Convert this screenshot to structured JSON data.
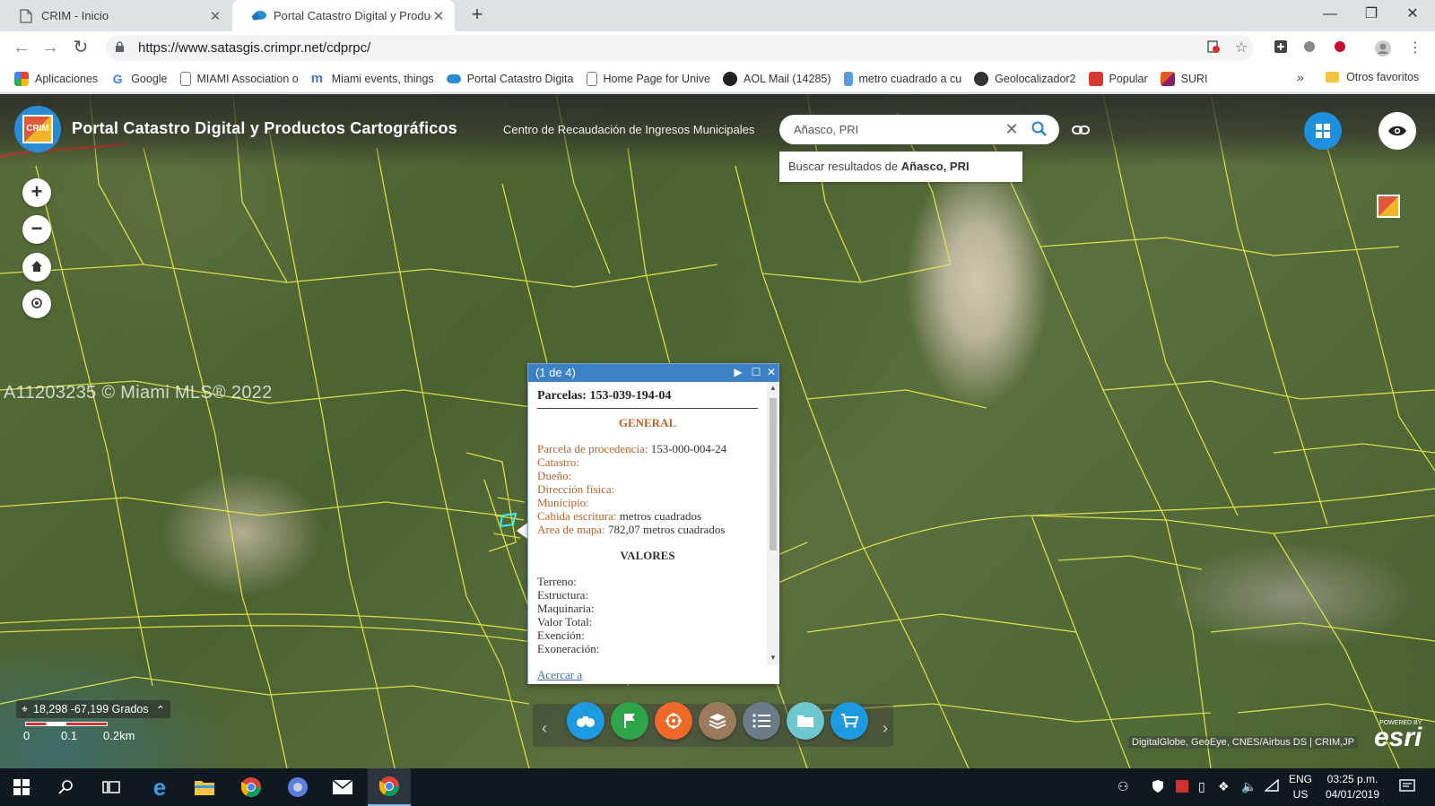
{
  "browser": {
    "tabs": [
      {
        "title": "CRIM - Inicio",
        "active": false
      },
      {
        "title": "Portal Catastro Digital y Producto",
        "active": true
      }
    ],
    "url": "https://www.satasgis.crimpr.net/cdprpc/",
    "bookmarks": [
      {
        "label": "Aplicaciones",
        "icon": "apps-grid-icon",
        "color": "#ea4335"
      },
      {
        "label": "Google",
        "icon": "google-icon",
        "color": "#4285f4"
      },
      {
        "label": "MIAMI Association o",
        "icon": "page-icon",
        "color": "#ffffff"
      },
      {
        "label": "Miami events, things",
        "icon": "m-logo-icon",
        "color": "#4a6fd0"
      },
      {
        "label": "Portal Catastro Digita",
        "icon": "cloud-icon",
        "color": "#2b8ad4"
      },
      {
        "label": "Home Page for Unive",
        "icon": "page-icon",
        "color": "#ffffff"
      },
      {
        "label": "AOL Mail (14285)",
        "icon": "aol-icon",
        "color": "#222222"
      },
      {
        "label": "metro cuadrado a cu",
        "icon": "bookmark-blue-icon",
        "color": "#5a9ae0"
      },
      {
        "label": "Geolocalizador2",
        "icon": "globe-icon",
        "color": "#333333"
      },
      {
        "label": "Popular",
        "icon": "popular-icon",
        "color": "#d6392f"
      },
      {
        "label": "SURI",
        "icon": "suri-icon",
        "color": "#e05a20"
      }
    ],
    "more": "»",
    "other_favorites": "Otros favoritos"
  },
  "app": {
    "title": "Portal Catastro Digital y Productos Cartográficos",
    "subtitle": "Centro de Recaudación de Ingresos Municipales",
    "search_value": "Añasco, PRI",
    "suggestion_prefix": "Buscar resultados de ",
    "suggestion_term": "Añasco, PRI"
  },
  "watermark": "A11203235 © Miami MLS® 2022",
  "popup": {
    "counter": "(1 de 4)",
    "parcel_title": "Parcelas: 153-039-194-04",
    "general_heading": "GENERAL",
    "general_rows": [
      {
        "key": "Parcela de procedencia:",
        "value": "153-000-004-24"
      },
      {
        "key": "Catastro:",
        "value": ""
      },
      {
        "key": "Dueño:",
        "value": ""
      },
      {
        "key": "Dirección física:",
        "value": ""
      },
      {
        "key": "Municipio:",
        "value": ""
      },
      {
        "key": "Cabida escritura:",
        "value": "metros cuadrados"
      },
      {
        "key": "Area de mapa:",
        "value": "782,07 metros cuadrados"
      }
    ],
    "valores_heading": "VALORES",
    "valores_rows": [
      "Terreno:",
      "Estructura:",
      "Maquinaria:",
      "Valor Total:",
      "Exención:",
      "Exoneración:"
    ],
    "footer_link": "Acercar a"
  },
  "map_status": {
    "coordinates": "18,298 -67,199 Grados",
    "scale_labels": [
      "0",
      "0.1",
      "0.2km"
    ],
    "attribution": "DigitalGlobe, GeoEye, CNES/Airbus DS | CRIM,JP",
    "esri_powered": "POWERED BY",
    "esri_name": "esri"
  },
  "toolbar_tools": [
    {
      "name": "binoculars-tool",
      "color": "#1e9be0"
    },
    {
      "name": "flag-tool",
      "color": "#2ea54a"
    },
    {
      "name": "measure-tool",
      "color": "#ef6a2a"
    },
    {
      "name": "layers-tool",
      "color": "#9b7a5e"
    },
    {
      "name": "list-tool",
      "color": "#6b7b8a"
    },
    {
      "name": "folder-tool",
      "color": "#6fc7d0"
    },
    {
      "name": "cart-tool",
      "color": "#1e9be0"
    }
  ],
  "taskbar": {
    "language": "ENG",
    "region": "US",
    "time": "03:25 p.m.",
    "date": "04/01/2019"
  }
}
